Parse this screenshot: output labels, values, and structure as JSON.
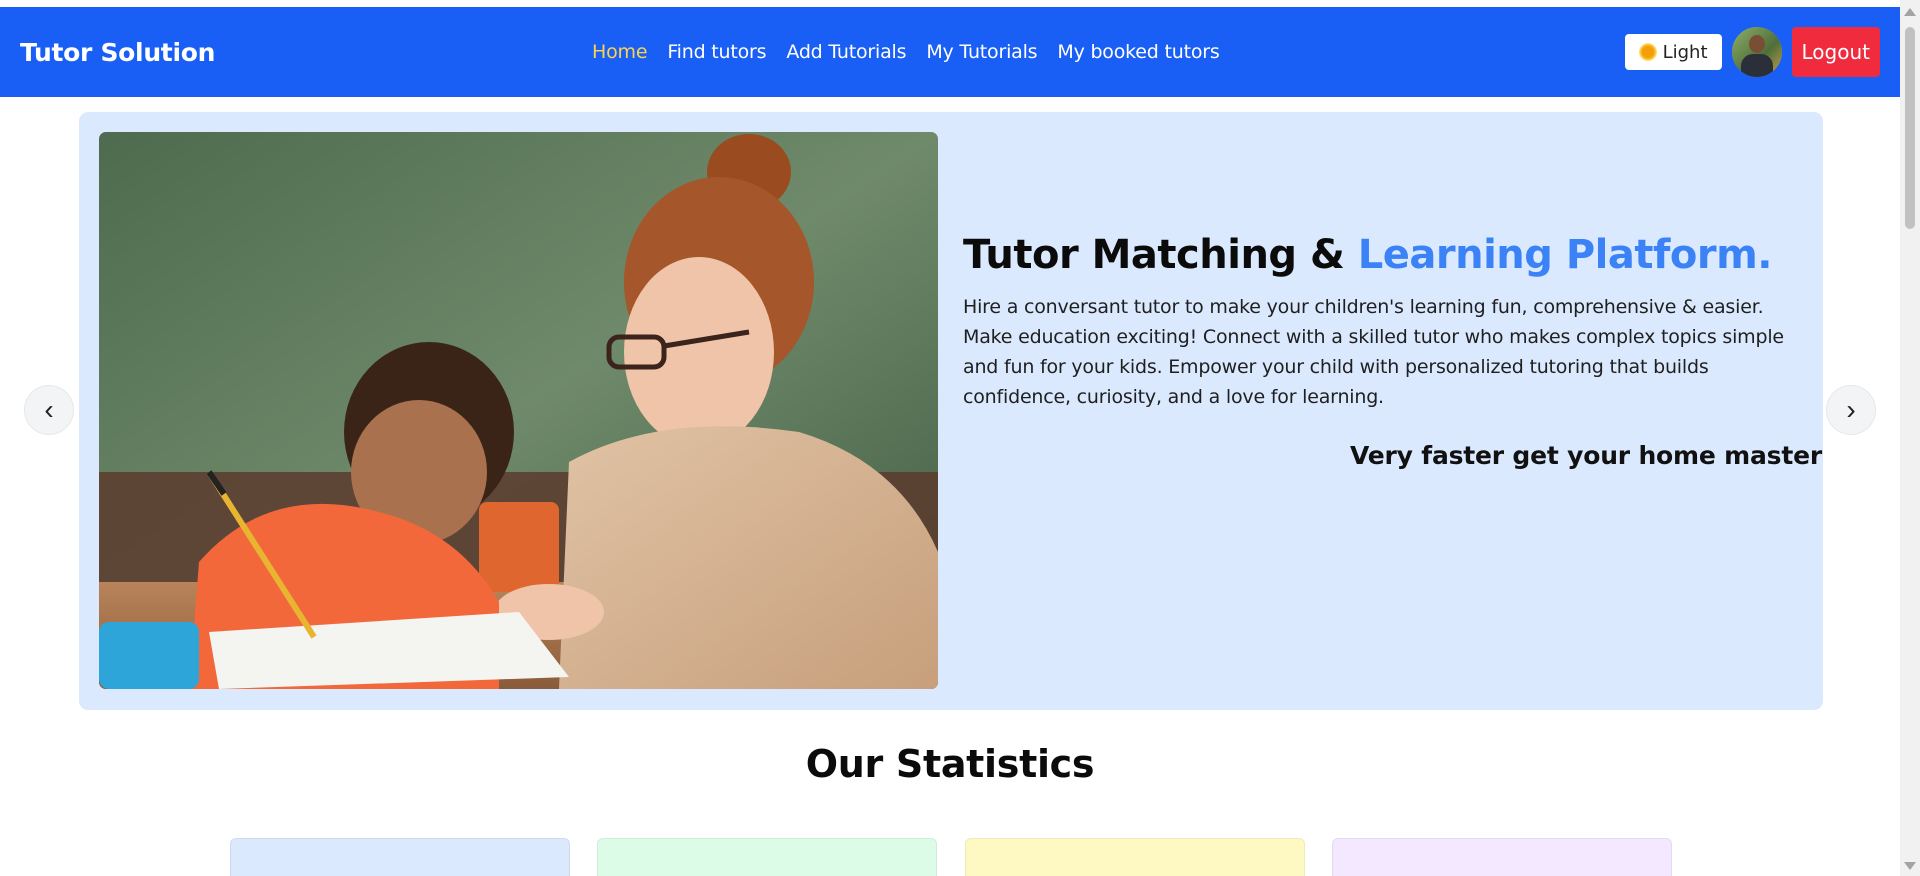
{
  "brand": "Tutor Solution",
  "nav": {
    "links": [
      "Home",
      "Find tutors",
      "Add Tutorials",
      "My Tutorials",
      "My booked tutors"
    ],
    "active": "Home",
    "theme_label": "Light",
    "logout_label": "Logout"
  },
  "hero": {
    "title_main": "Tutor Matching & ",
    "title_accent": "Learning Platform.",
    "description": "Hire a conversant tutor to make your children's learning fun, comprehensive & easier. Make education exciting! Connect with a skilled tutor who makes complex topics simple and fun for your kids. Empower your child with personalized tutoring that builds confidence, curiosity, and a love for learning.",
    "tagline": "Very faster get your home master",
    "prev_label": "‹",
    "next_label": "›"
  },
  "stats": {
    "title": "Our Statistics"
  },
  "colors": {
    "navbar": "#1a5ff5",
    "active_link": "#fcd34d",
    "hero_bg": "#dbe9fe",
    "accent": "#3b82f6",
    "logout": "#ef2b3d",
    "stat_cards": [
      "#dbe9fe",
      "#dcfce7",
      "#fef9c3",
      "#f3e8ff"
    ]
  },
  "icons": {
    "theme": "sun-icon",
    "avatar": "user-avatar"
  }
}
